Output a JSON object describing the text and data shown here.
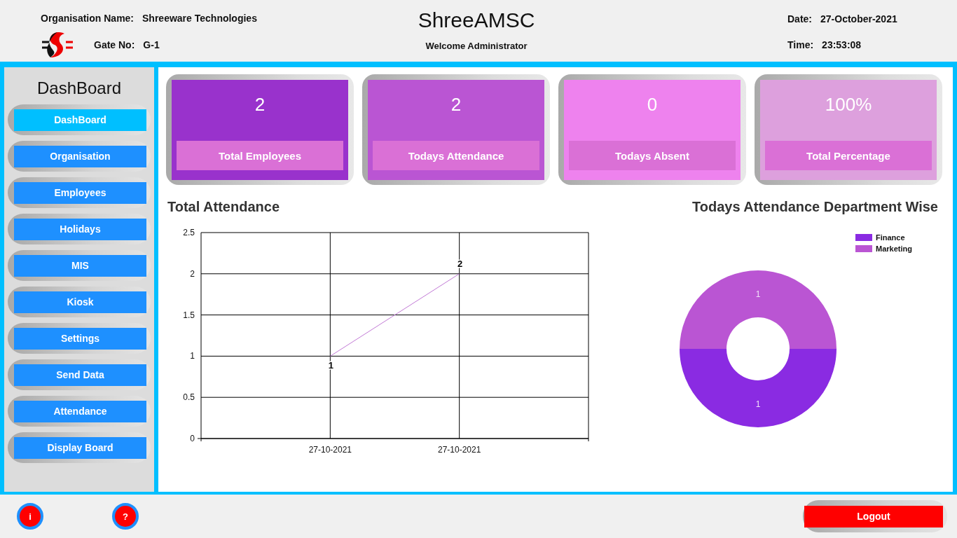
{
  "header": {
    "organisation_label": "Organisation Name:",
    "organisation_name": "Shreeware Technologies",
    "gate_label": "Gate No:",
    "gate_no": "G-1",
    "app_title": "ShreeAMSC",
    "welcome": "Welcome Administrator",
    "date_label": "Date:",
    "date": "27-October-2021",
    "time_label": "Time:",
    "time": "23:53:08"
  },
  "sidebar": {
    "title": "DashBoard",
    "items": [
      {
        "label": "DashBoard",
        "selected": true
      },
      {
        "label": "Organisation",
        "selected": false
      },
      {
        "label": "Employees",
        "selected": false
      },
      {
        "label": "Holidays",
        "selected": false
      },
      {
        "label": "MIS",
        "selected": false
      },
      {
        "label": "Kiosk",
        "selected": false
      },
      {
        "label": "Settings",
        "selected": false
      },
      {
        "label": "Send Data",
        "selected": false
      },
      {
        "label": "Attendance",
        "selected": false
      },
      {
        "label": "Display Board",
        "selected": false
      }
    ]
  },
  "cards": [
    {
      "value": "2",
      "label": "Total Employees",
      "color": "#9932cc"
    },
    {
      "value": "2",
      "label": "Todays Attendance",
      "color": "#ba55d3"
    },
    {
      "value": "0",
      "label": "Todays Absent",
      "color": "#ee82ee"
    },
    {
      "value": "100%",
      "label": "Total Percentage",
      "color": "#dda0dd"
    }
  ],
  "line_chart": {
    "chart_data": {
      "type": "line",
      "title": "Total Attendance",
      "categories": [
        "27-10-2021",
        "27-10-2021"
      ],
      "series": [
        {
          "color": "#c27ad6",
          "values": [
            1,
            2
          ]
        }
      ],
      "ylim": [
        0,
        2.5
      ],
      "yticks": [
        0,
        0.5,
        1,
        1.5,
        2,
        2.5
      ],
      "grid": true,
      "data_labels": true
    }
  },
  "donut_chart": {
    "chart_data": {
      "type": "donut",
      "title": "Todays Attendance Department Wise",
      "categories": [
        "Finance",
        "Marketing"
      ],
      "values": [
        1,
        1
      ],
      "colors": [
        "#8a2be2",
        "#ba55d3"
      ],
      "legend": true,
      "data_labels": true
    }
  },
  "footer": {
    "info_button": "i",
    "help_button": "?",
    "logout_button": "Logout"
  }
}
